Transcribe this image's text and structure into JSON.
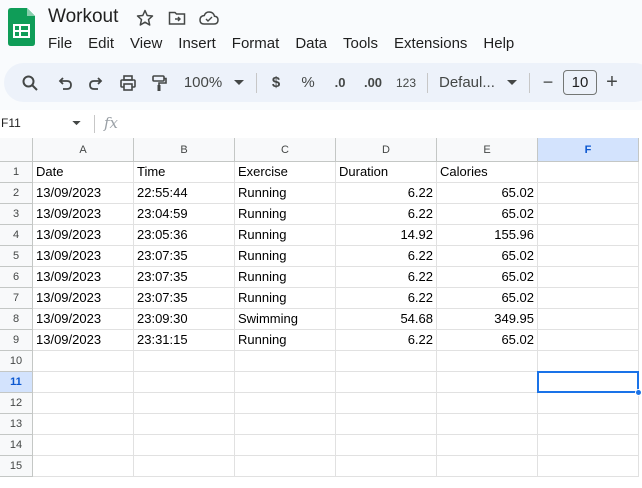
{
  "doc": {
    "title": "Workout"
  },
  "menu": [
    "File",
    "Edit",
    "View",
    "Insert",
    "Format",
    "Data",
    "Tools",
    "Extensions",
    "Help"
  ],
  "toolbar": {
    "zoom": "100%",
    "currency": "$",
    "percent": "%",
    "dec_decrease": ".0",
    "dec_increase": ".00",
    "number_format": "123",
    "font": "Defaul...",
    "minus": "−",
    "font_size": "10",
    "plus": "+"
  },
  "formula_bar": {
    "name_box": "F11",
    "fx": "fx",
    "value": ""
  },
  "sheet": {
    "columns": [
      "A",
      "B",
      "C",
      "D",
      "E",
      "F"
    ],
    "selected_column": "F",
    "row_numbers": [
      "1",
      "2",
      "3",
      "4",
      "5",
      "6",
      "7",
      "8",
      "9",
      "10",
      "11",
      "12",
      "13",
      "14",
      "15"
    ],
    "selected_row": "11",
    "rows": [
      [
        "Date",
        "Time",
        "Exercise",
        "Duration",
        "Calories"
      ],
      [
        "13/09/2023",
        "22:55:44",
        "Running",
        "6.22",
        "65.02"
      ],
      [
        "13/09/2023",
        "23:04:59",
        "Running",
        "6.22",
        "65.02"
      ],
      [
        "13/09/2023",
        "23:05:36",
        "Running",
        "14.92",
        "155.96"
      ],
      [
        "13/09/2023",
        "23:07:35",
        "Running",
        "6.22",
        "65.02"
      ],
      [
        "13/09/2023",
        "23:07:35",
        "Running",
        "6.22",
        "65.02"
      ],
      [
        "13/09/2023",
        "23:07:35",
        "Running",
        "6.22",
        "65.02"
      ],
      [
        "13/09/2023",
        "23:09:30",
        "Swimming",
        "54.68",
        "349.95"
      ],
      [
        "13/09/2023",
        "23:31:15",
        "Running",
        "6.22",
        "65.02"
      ]
    ],
    "numeric_columns": [
      3,
      4
    ],
    "active_cell": "F11"
  },
  "colors": {
    "accent": "#1a73e8",
    "selected_header": "#d3e3fd",
    "logo_green": "#0f9d58"
  }
}
